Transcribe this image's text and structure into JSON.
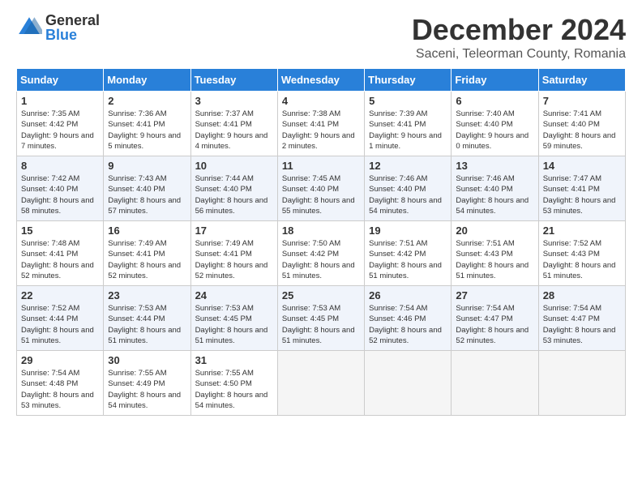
{
  "logo": {
    "general": "General",
    "blue": "Blue"
  },
  "title": "December 2024",
  "subtitle": "Saceni, Teleorman County, Romania",
  "headers": [
    "Sunday",
    "Monday",
    "Tuesday",
    "Wednesday",
    "Thursday",
    "Friday",
    "Saturday"
  ],
  "weeks": [
    [
      {
        "day": "1",
        "sunrise": "7:35 AM",
        "sunset": "4:42 PM",
        "daylight": "9 hours and 7 minutes."
      },
      {
        "day": "2",
        "sunrise": "7:36 AM",
        "sunset": "4:41 PM",
        "daylight": "9 hours and 5 minutes."
      },
      {
        "day": "3",
        "sunrise": "7:37 AM",
        "sunset": "4:41 PM",
        "daylight": "9 hours and 4 minutes."
      },
      {
        "day": "4",
        "sunrise": "7:38 AM",
        "sunset": "4:41 PM",
        "daylight": "9 hours and 2 minutes."
      },
      {
        "day": "5",
        "sunrise": "7:39 AM",
        "sunset": "4:41 PM",
        "daylight": "9 hours and 1 minute."
      },
      {
        "day": "6",
        "sunrise": "7:40 AM",
        "sunset": "4:40 PM",
        "daylight": "9 hours and 0 minutes."
      },
      {
        "day": "7",
        "sunrise": "7:41 AM",
        "sunset": "4:40 PM",
        "daylight": "8 hours and 59 minutes."
      }
    ],
    [
      {
        "day": "8",
        "sunrise": "7:42 AM",
        "sunset": "4:40 PM",
        "daylight": "8 hours and 58 minutes."
      },
      {
        "day": "9",
        "sunrise": "7:43 AM",
        "sunset": "4:40 PM",
        "daylight": "8 hours and 57 minutes."
      },
      {
        "day": "10",
        "sunrise": "7:44 AM",
        "sunset": "4:40 PM",
        "daylight": "8 hours and 56 minutes."
      },
      {
        "day": "11",
        "sunrise": "7:45 AM",
        "sunset": "4:40 PM",
        "daylight": "8 hours and 55 minutes."
      },
      {
        "day": "12",
        "sunrise": "7:46 AM",
        "sunset": "4:40 PM",
        "daylight": "8 hours and 54 minutes."
      },
      {
        "day": "13",
        "sunrise": "7:46 AM",
        "sunset": "4:40 PM",
        "daylight": "8 hours and 54 minutes."
      },
      {
        "day": "14",
        "sunrise": "7:47 AM",
        "sunset": "4:41 PM",
        "daylight": "8 hours and 53 minutes."
      }
    ],
    [
      {
        "day": "15",
        "sunrise": "7:48 AM",
        "sunset": "4:41 PM",
        "daylight": "8 hours and 52 minutes."
      },
      {
        "day": "16",
        "sunrise": "7:49 AM",
        "sunset": "4:41 PM",
        "daylight": "8 hours and 52 minutes."
      },
      {
        "day": "17",
        "sunrise": "7:49 AM",
        "sunset": "4:41 PM",
        "daylight": "8 hours and 52 minutes."
      },
      {
        "day": "18",
        "sunrise": "7:50 AM",
        "sunset": "4:42 PM",
        "daylight": "8 hours and 51 minutes."
      },
      {
        "day": "19",
        "sunrise": "7:51 AM",
        "sunset": "4:42 PM",
        "daylight": "8 hours and 51 minutes."
      },
      {
        "day": "20",
        "sunrise": "7:51 AM",
        "sunset": "4:43 PM",
        "daylight": "8 hours and 51 minutes."
      },
      {
        "day": "21",
        "sunrise": "7:52 AM",
        "sunset": "4:43 PM",
        "daylight": "8 hours and 51 minutes."
      }
    ],
    [
      {
        "day": "22",
        "sunrise": "7:52 AM",
        "sunset": "4:44 PM",
        "daylight": "8 hours and 51 minutes."
      },
      {
        "day": "23",
        "sunrise": "7:53 AM",
        "sunset": "4:44 PM",
        "daylight": "8 hours and 51 minutes."
      },
      {
        "day": "24",
        "sunrise": "7:53 AM",
        "sunset": "4:45 PM",
        "daylight": "8 hours and 51 minutes."
      },
      {
        "day": "25",
        "sunrise": "7:53 AM",
        "sunset": "4:45 PM",
        "daylight": "8 hours and 51 minutes."
      },
      {
        "day": "26",
        "sunrise": "7:54 AM",
        "sunset": "4:46 PM",
        "daylight": "8 hours and 52 minutes."
      },
      {
        "day": "27",
        "sunrise": "7:54 AM",
        "sunset": "4:47 PM",
        "daylight": "8 hours and 52 minutes."
      },
      {
        "day": "28",
        "sunrise": "7:54 AM",
        "sunset": "4:47 PM",
        "daylight": "8 hours and 53 minutes."
      }
    ],
    [
      {
        "day": "29",
        "sunrise": "7:54 AM",
        "sunset": "4:48 PM",
        "daylight": "8 hours and 53 minutes."
      },
      {
        "day": "30",
        "sunrise": "7:55 AM",
        "sunset": "4:49 PM",
        "daylight": "8 hours and 54 minutes."
      },
      {
        "day": "31",
        "sunrise": "7:55 AM",
        "sunset": "4:50 PM",
        "daylight": "8 hours and 54 minutes."
      },
      null,
      null,
      null,
      null
    ]
  ]
}
